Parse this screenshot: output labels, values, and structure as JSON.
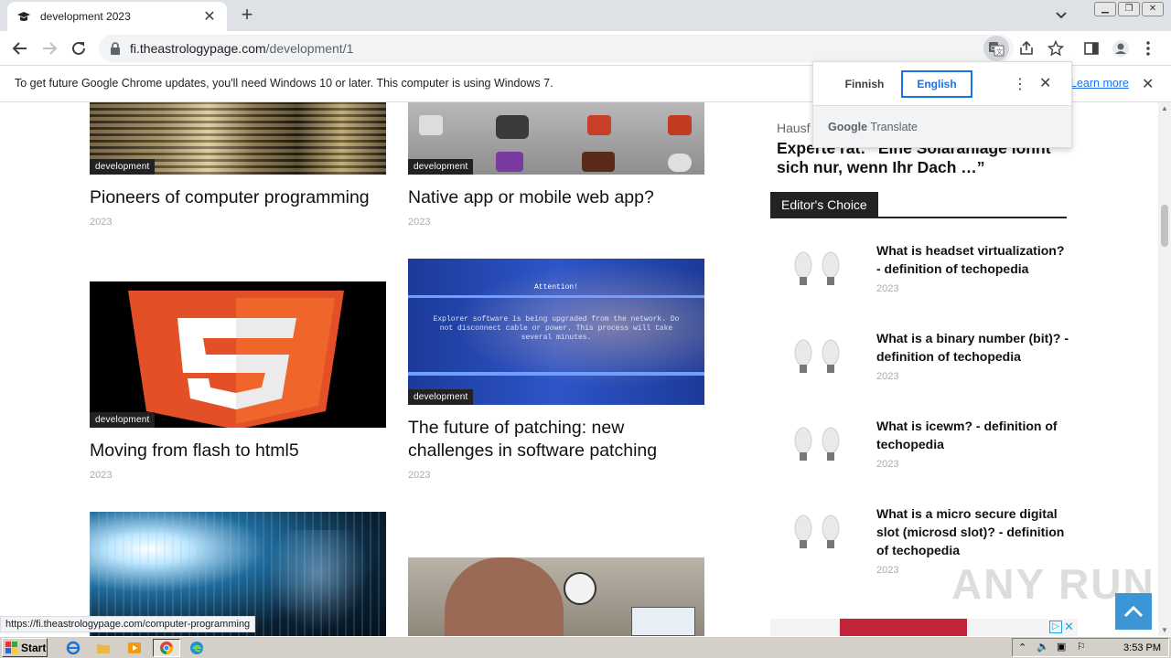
{
  "browser": {
    "tab_title": "development 2023",
    "url_host": "fi.theastrologypage.com",
    "url_path": "/development/1"
  },
  "infobar": {
    "message": "To get future Google Chrome updates, you'll need Windows 10 or later. This computer is using Windows 7.",
    "learn_more": "Learn more"
  },
  "translate_popup": {
    "source_lang": "Finnish",
    "target_lang": "English",
    "brand_google": "Google",
    "brand_translate": "Translate"
  },
  "articles": [
    {
      "category": "development",
      "title": "Pioneers of computer programming",
      "date": "2023"
    },
    {
      "category": "development",
      "title": "Native app or mobile web app?",
      "date": "2023"
    },
    {
      "category": "development",
      "title": "Moving from flash to html5",
      "date": "2023"
    },
    {
      "category": "development",
      "title": "The future of patching: new challenges in software patching",
      "date": "2023"
    }
  ],
  "thumb_text": {
    "patch_attention": "Attention!",
    "patch_body": "Explorer software is being upgraded from the network. Do not disconnect cable or power. This process will take several minutes."
  },
  "sidebar": {
    "ad_source": "Hausf",
    "ad_headline": "Experte rät: “Eine Solaranlage lohnt sich nur, wenn Ihr Dach …”",
    "section_title": "Editor's Choice",
    "items": [
      {
        "title": "What is headset virtualization? - definition of techopedia",
        "date": "2023"
      },
      {
        "title": "What is a binary number (bit)? - definition of techopedia",
        "date": "2023"
      },
      {
        "title": "What is icewm? - definition of techopedia",
        "date": "2023"
      },
      {
        "title": "What is a micro secure digital slot (microsd slot)? - definition of techopedia",
        "date": "2023"
      }
    ]
  },
  "status_url": "https://fi.theastrologypage.com/computer-programming",
  "watermark": "ANY RUN",
  "taskbar": {
    "start": "Start",
    "clock": "3:53 PM"
  },
  "colors": {
    "accent_blue": "#1a73e8",
    "category_bg": "#222222",
    "totop_bg": "#3c96d6"
  }
}
